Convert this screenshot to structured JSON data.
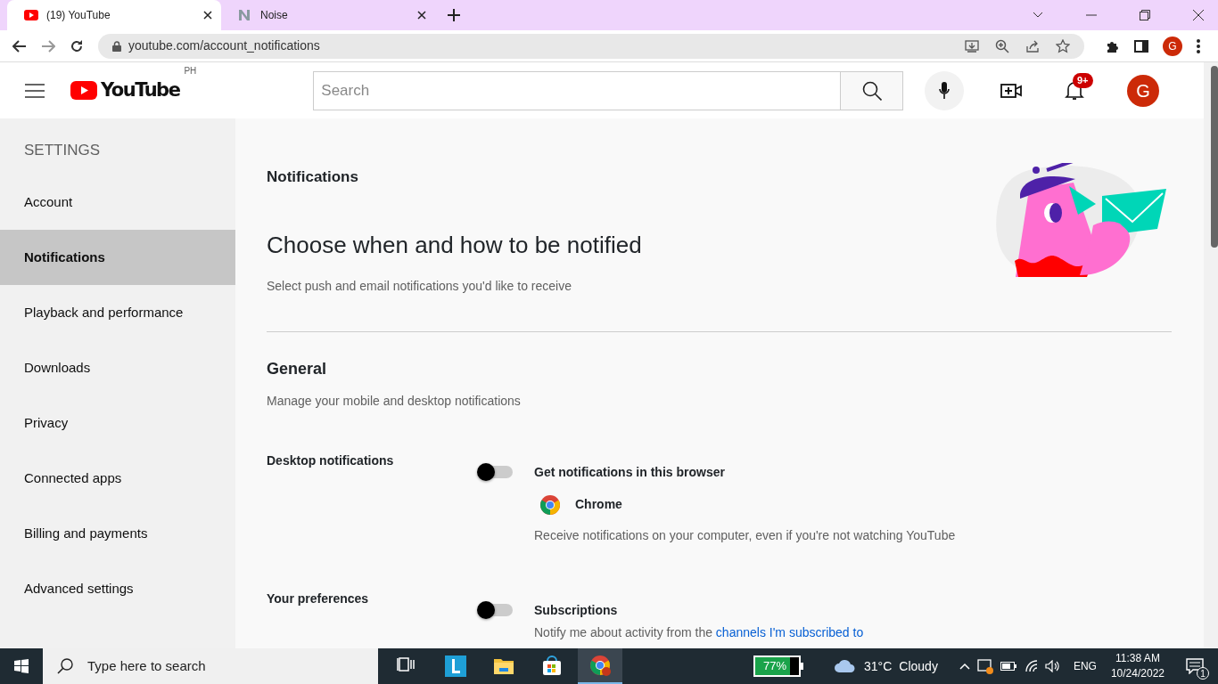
{
  "browser": {
    "tabs": [
      {
        "title": "(19) YouTube",
        "kind": "youtube",
        "selected": true
      },
      {
        "title": "Noise",
        "kind": "noise",
        "selected": false
      }
    ],
    "address": "youtube.com/account_notifications",
    "profile": "G"
  },
  "header": {
    "logo": "YouTube",
    "region": "PH",
    "search": {
      "placeholder": "Search"
    },
    "notification_badge": "9+",
    "avatar": "G"
  },
  "sidebar": {
    "title": "SETTINGS",
    "items": [
      {
        "label": "Account",
        "selected": false
      },
      {
        "label": "Notifications",
        "selected": true
      },
      {
        "label": "Playback and performance",
        "selected": false
      },
      {
        "label": "Downloads",
        "selected": false
      },
      {
        "label": "Privacy",
        "selected": false
      },
      {
        "label": "Connected apps",
        "selected": false
      },
      {
        "label": "Billing and payments",
        "selected": false
      },
      {
        "label": "Advanced settings",
        "selected": false
      }
    ]
  },
  "main": {
    "section_title": "Notifications",
    "heading": "Choose when and how to be notified",
    "subheading": "Select push and email notifications you'd like to receive",
    "general": {
      "title": "General",
      "description": "Manage your mobile and desktop notifications"
    },
    "settings": [
      {
        "group": "Desktop notifications",
        "title": "Get notifications in this browser",
        "on": false,
        "browser": "Chrome",
        "description": "Receive notifications on your computer, even if you're not watching YouTube"
      },
      {
        "group": "Your preferences",
        "title": "Subscriptions",
        "on": false,
        "description": "Notify me about activity from the",
        "link": "channels I'm subscribed to"
      }
    ]
  },
  "taskbar": {
    "search": {
      "placeholder": "Type here to search"
    },
    "apps": [
      {
        "kind": "taskview",
        "selected": false
      },
      {
        "kind": "launcher",
        "selected": false
      },
      {
        "kind": "folder",
        "selected": false
      },
      {
        "kind": "store",
        "selected": false
      },
      {
        "kind": "chrome",
        "selected": true
      }
    ],
    "battery": "77%",
    "temperature": "31°C",
    "weather": "Cloudy",
    "language": "ENG",
    "time": "11:38 AM",
    "date": "10/24/2022",
    "notification_count": "1"
  }
}
